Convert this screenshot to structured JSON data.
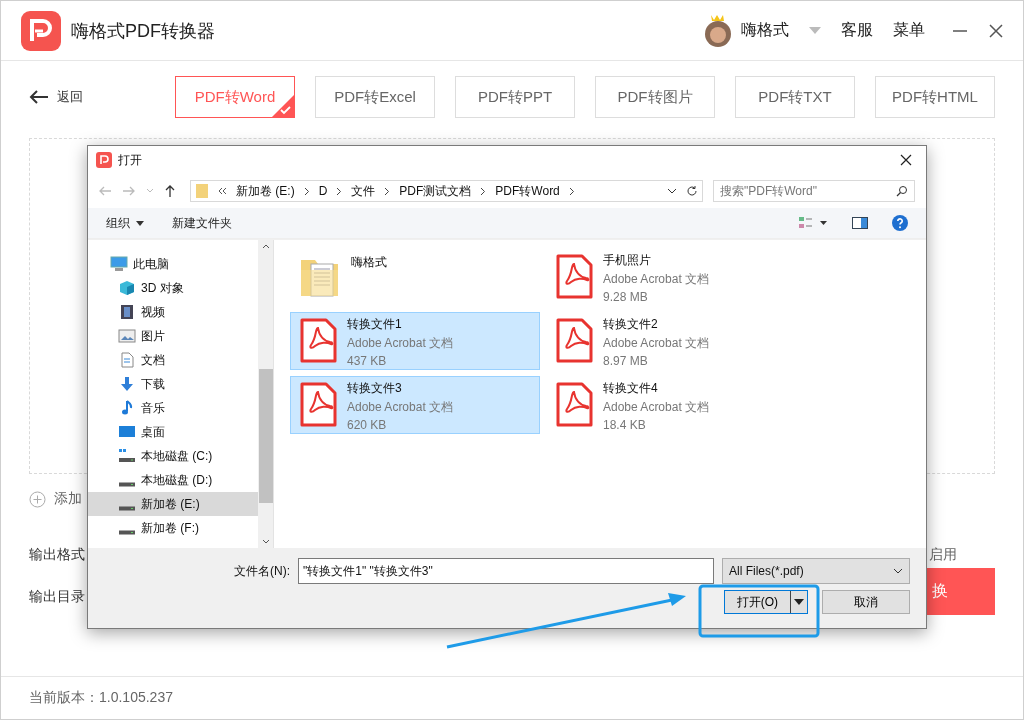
{
  "app": {
    "title": "嗨格式PDF转换器",
    "user": "嗨格式",
    "links": [
      "客服",
      "菜单"
    ]
  },
  "toolbar": {
    "back": "返回",
    "tabs": [
      {
        "label": "PDF转Word",
        "selected": true
      },
      {
        "label": "PDF转Excel",
        "selected": false
      },
      {
        "label": "PDF转PPT",
        "selected": false
      },
      {
        "label": "PDF转图片",
        "selected": false
      },
      {
        "label": "PDF转TXT",
        "selected": false
      },
      {
        "label": "PDF转HTML",
        "selected": false
      }
    ]
  },
  "drop_area": {
    "add_label": "添加"
  },
  "options": {
    "format_label": "输出格式",
    "enable_label": "启用",
    "dir_label": "输出目录",
    "convert_button": "换"
  },
  "status_bar": {
    "version": "当前版本：1.0.105.237"
  },
  "dialog": {
    "title": "打开",
    "path": [
      "新加卷 (E:)",
      "D",
      "文件",
      "PDF测试文档",
      "PDF转Word"
    ],
    "search": {
      "placeholder": "搜索\"PDF转Word\""
    },
    "commands": [
      "组织",
      "新建文件夹"
    ],
    "nav": [
      {
        "label": "此电脑",
        "kind": "pc",
        "selected": false,
        "children": [
          {
            "label": "3D 对象",
            "kind": "cube",
            "selected": false
          },
          {
            "label": "视频",
            "kind": "video",
            "selected": false
          },
          {
            "label": "图片",
            "kind": "pictures",
            "selected": false
          },
          {
            "label": "文档",
            "kind": "document",
            "selected": false
          },
          {
            "label": "下载",
            "kind": "download",
            "selected": false
          },
          {
            "label": "音乐",
            "kind": "music",
            "selected": false
          },
          {
            "label": "桌面",
            "kind": "desktop",
            "selected": false
          },
          {
            "label": "本地磁盘 (C:)",
            "kind": "system-drive",
            "selected": false
          },
          {
            "label": "本地磁盘 (D:)",
            "kind": "drive",
            "selected": false
          },
          {
            "label": "新加卷 (E:)",
            "kind": "drive",
            "selected": true
          },
          {
            "label": "新加卷 (F:)",
            "kind": "drive",
            "selected": false
          }
        ]
      }
    ],
    "files": [
      {
        "name": "嗨格式",
        "kind": "folder",
        "selected": false
      },
      {
        "name": "手机照片",
        "kind": "pdf",
        "type": "Adobe Acrobat 文档",
        "size": "9.28 MB",
        "selected": false
      },
      {
        "name": "转换文件1",
        "kind": "pdf",
        "type": "Adobe Acrobat 文档",
        "size": "437 KB",
        "selected": true
      },
      {
        "name": "转换文件2",
        "kind": "pdf",
        "type": "Adobe Acrobat 文档",
        "size": "8.97 MB",
        "selected": false
      },
      {
        "name": "转换文件3",
        "kind": "pdf",
        "type": "Adobe Acrobat 文档",
        "size": "620 KB",
        "selected": true
      },
      {
        "name": "转换文件4",
        "kind": "pdf",
        "type": "Adobe Acrobat 文档",
        "size": "18.4 KB",
        "selected": false
      }
    ],
    "filename_label": "文件名(N):",
    "filename": "\"转换文件1\" \"转换文件3\"",
    "filter": "All Files(*.pdf)",
    "open_button": "打开(O)",
    "cancel_button": "取消"
  }
}
